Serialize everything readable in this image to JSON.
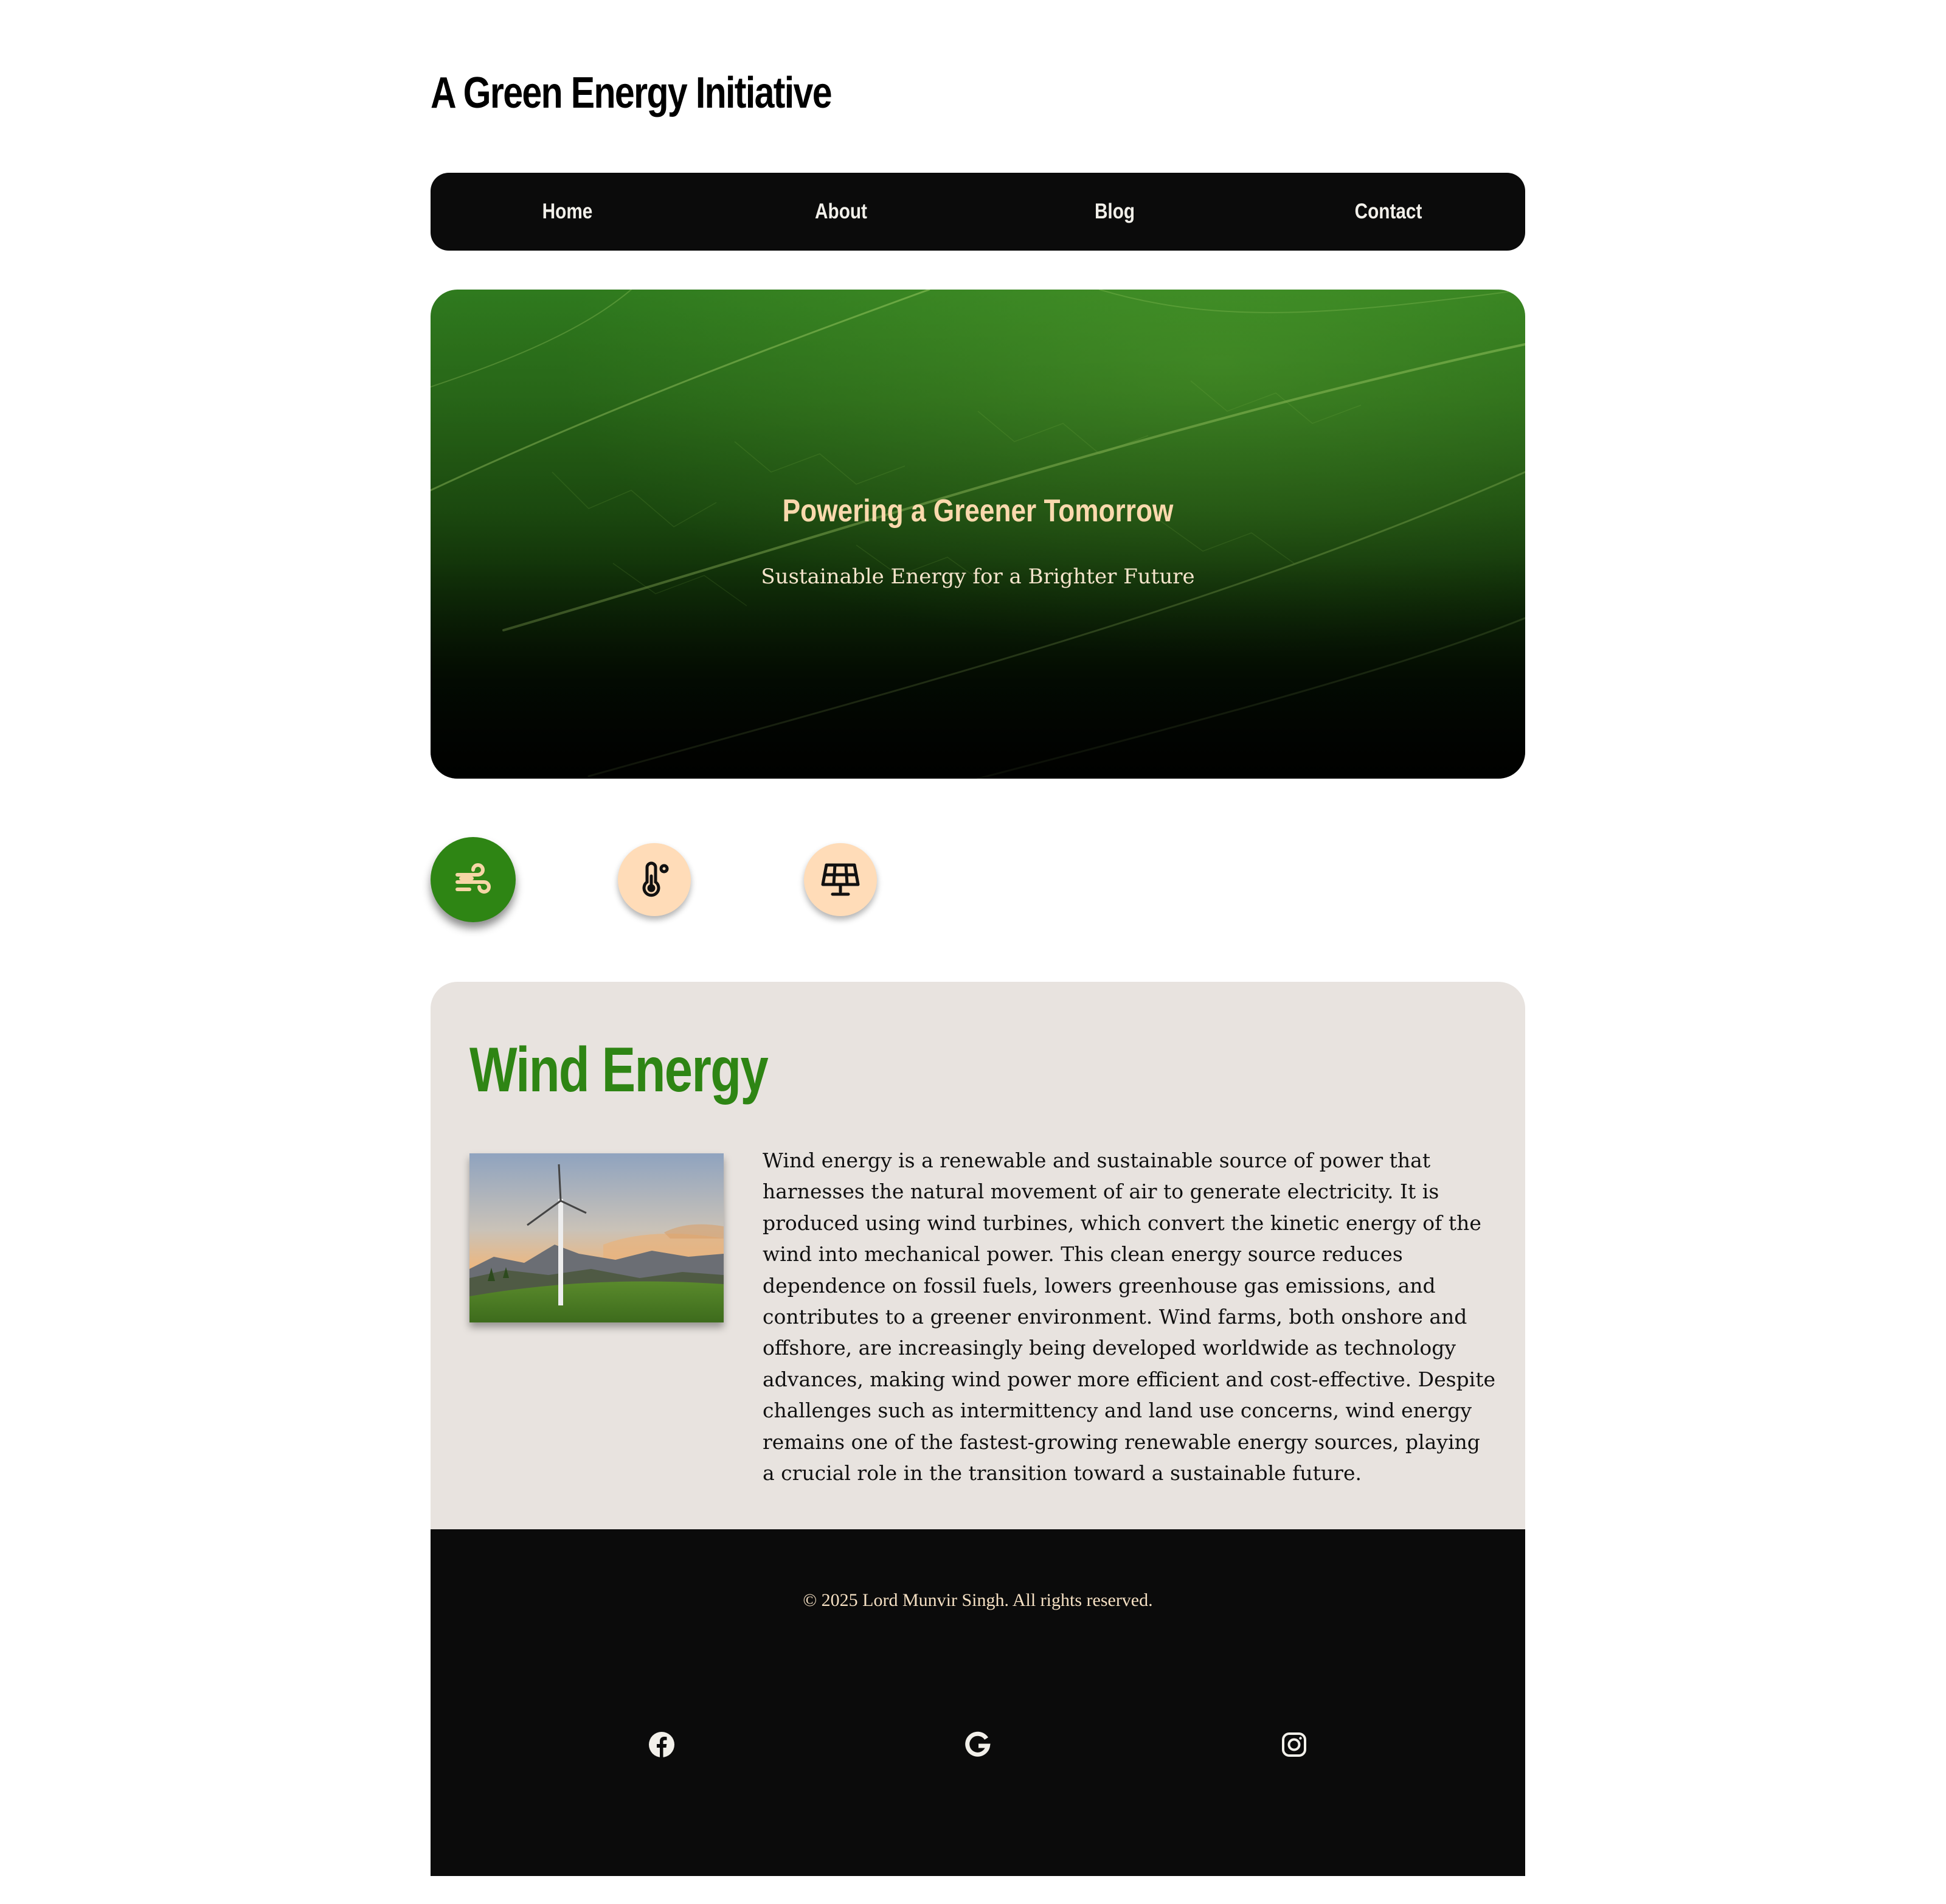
{
  "site": {
    "title": "A Green Energy Initiative"
  },
  "nav": {
    "items": [
      "Home",
      "About",
      "Blog",
      "Contact"
    ]
  },
  "hero": {
    "title": "Powering a Greener Tomorrow",
    "subtitle": "Sustainable Energy for a Brighter Future"
  },
  "energy_tabs": [
    {
      "icon": "wind-icon",
      "active": true
    },
    {
      "icon": "thermometer-icon",
      "active": false
    },
    {
      "icon": "solar-panel-icon",
      "active": false
    }
  ],
  "section": {
    "title": "Wind Energy",
    "body": "Wind energy is a renewable and sustainable source of power that harnesses the natural movement of air to generate electricity. It is produced using wind turbines, which convert the kinetic energy of the wind into mechanical power. This clean energy source reduces dependence on fossil fuels, lowers greenhouse gas emissions, and contributes to a greener environment. Wind farms, both onshore and offshore, are increasingly being developed worldwide as technology advances, making wind power more efficient and cost-effective. Despite challenges such as intermittency and land use concerns, wind energy remains one of the fastest-growing renewable energy sources, playing a crucial role in the transition toward a sustainable future."
  },
  "footer": {
    "copyright": "© 2025 Lord Munvir Singh. All rights reserved.",
    "social": [
      "facebook-icon",
      "google-icon",
      "instagram-icon"
    ]
  },
  "colors": {
    "accent_green": "#2e8514",
    "peach": "#ffdcb8",
    "dark": "#0b0b0b",
    "card_bg": "#e8e3df"
  }
}
